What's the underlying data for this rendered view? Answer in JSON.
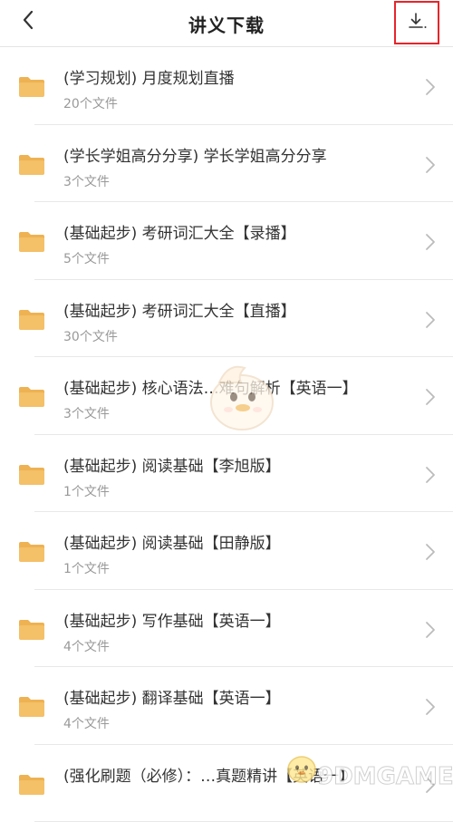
{
  "header": {
    "title": "讲义下载",
    "back_icon": "chevron-left-icon",
    "download_icon": "download-icon",
    "download_highlight_color": "#e8242a"
  },
  "colors": {
    "folder": "#f4c068",
    "folder_tab": "#eeb252",
    "title_text": "#333333",
    "subtitle_text": "#999999",
    "chevron": "#bbbbbb"
  },
  "items": [
    {
      "title": "(学习规划) 月度规划直播",
      "count": "20个文件"
    },
    {
      "title": "(学长学姐高分分享) 学长学姐高分分享",
      "count": "3个文件"
    },
    {
      "title": "(基础起步) 考研词汇大全【录播】",
      "count": "5个文件"
    },
    {
      "title": "(基础起步) 考研词汇大全【直播】",
      "count": "30个文件"
    },
    {
      "title": "(基础起步) 核心语法…难句解析【英语一】",
      "count": "3个文件"
    },
    {
      "title": "(基础起步) 阅读基础【李旭版】",
      "count": "1个文件"
    },
    {
      "title": "(基础起步) 阅读基础【田静版】",
      "count": "1个文件"
    },
    {
      "title": "(基础起步) 写作基础【英语一】",
      "count": "4个文件"
    },
    {
      "title": "(基础起步) 翻译基础【英语一】",
      "count": "4个文件"
    },
    {
      "title": "(强化刷题（必修）：…真题精讲【英语一】",
      "count": ""
    }
  ],
  "watermark": {
    "text": "9DMGAME"
  }
}
